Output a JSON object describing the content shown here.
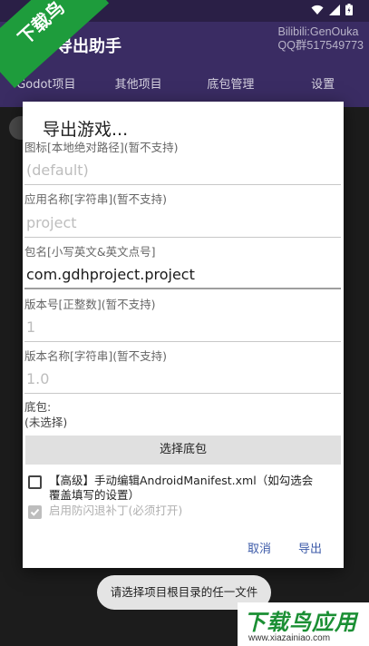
{
  "app": {
    "title": "导出助手",
    "bili_line1": "Bilibili:GenOuka",
    "bili_line2": "QQ群517549773"
  },
  "tabs": [
    "Godot项目",
    "其他项目",
    "底包管理",
    "设置"
  ],
  "watermark": {
    "logo_text": "下载鸟",
    "brand_text": "下载鸟应用",
    "brand_url": "www.xiazainiao.com"
  },
  "dialog": {
    "title": "导出游戏...",
    "fields": [
      {
        "label": "图标[本地绝对路径](暂不支持)",
        "value": "(default)",
        "active": false
      },
      {
        "label": "应用名称[字符串](暂不支持)",
        "value": "project",
        "active": false
      },
      {
        "label": "包名[小写英文&英文点号]",
        "value": "com.gdhproject.project",
        "active": true
      },
      {
        "label": "版本号[正整数](暂不支持)",
        "value": "1",
        "active": false
      },
      {
        "label": "版本名称[字符串](暂不支持)",
        "value": "1.0",
        "active": false
      }
    ],
    "base_label": "底包:",
    "base_value": "(未选择)",
    "choose_base_button": "选择底包",
    "checkbox_manifest": "【高级】手动编辑AndroidManifest.xml（如勾选会覆盖填写的设置）",
    "checkbox_antiflash": "启用防闪退补丁(必须打开)",
    "cancel": "取消",
    "export": "导出"
  },
  "toast": "请选择项目根目录的任一文件",
  "colors": {
    "app_bar": "#3a2c63",
    "accent_button_text": "#3c5aa8",
    "watermark_green": "#1e9c3c"
  }
}
